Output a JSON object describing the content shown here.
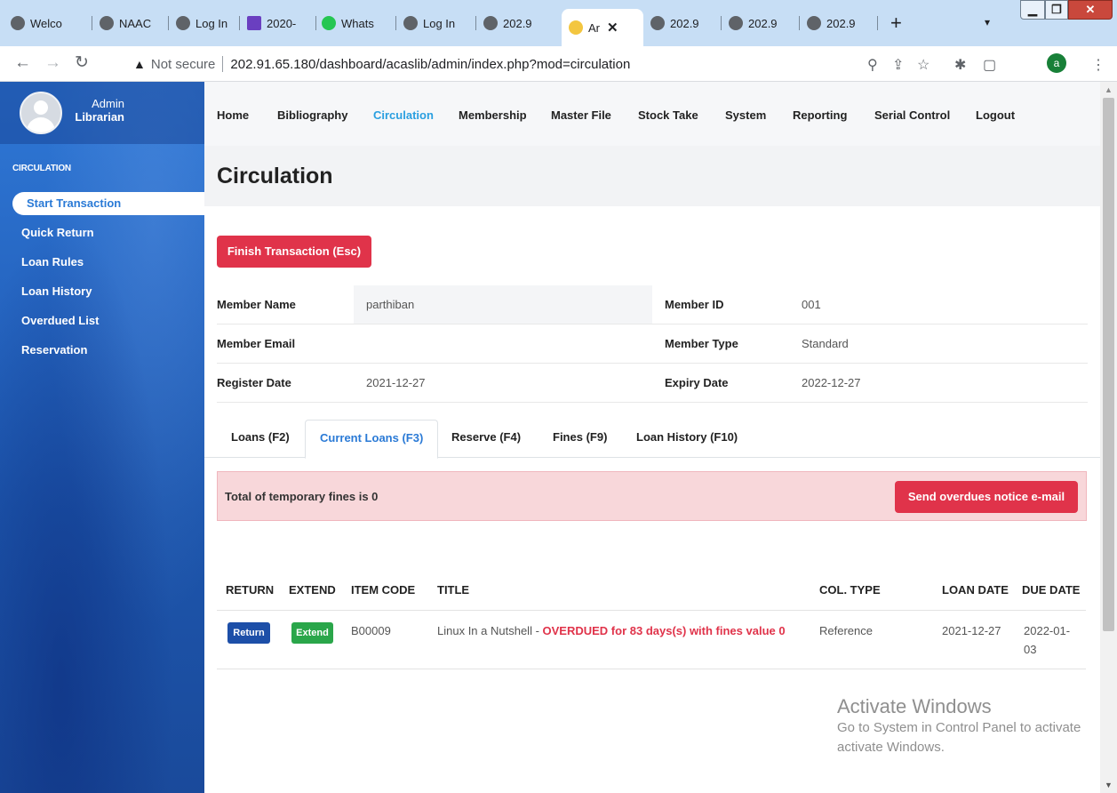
{
  "browser": {
    "tabs": [
      {
        "title": "Welco",
        "icon": "globe-icon"
      },
      {
        "title": "NAAC",
        "icon": "globe-icon"
      },
      {
        "title": "Log In",
        "icon": "globe-icon"
      },
      {
        "title": "2020-",
        "icon": "forms-icon"
      },
      {
        "title": "Whats",
        "icon": "whatsapp-icon"
      },
      {
        "title": "Log In",
        "icon": "globe-icon"
      },
      {
        "title": "202.9",
        "icon": "globe-icon"
      },
      {
        "title": "Ar",
        "icon": "smile-icon",
        "active": true
      },
      {
        "title": "202.9",
        "icon": "globe-icon"
      },
      {
        "title": "202.9",
        "icon": "globe-icon"
      },
      {
        "title": "202.9",
        "icon": "globe-icon"
      }
    ],
    "security_label": "Not secure",
    "url": "202.91.65.180/dashboard/acaslib/admin/index.php?mod=circulation",
    "profile_initial": "a"
  },
  "sidebar": {
    "user_role": "Admin",
    "user_title": "Librarian",
    "section": "CIRCULATION",
    "items": [
      {
        "label": "Start Transaction",
        "active": true
      },
      {
        "label": "Quick Return"
      },
      {
        "label": "Loan Rules"
      },
      {
        "label": "Loan History"
      },
      {
        "label": "Overdued List"
      },
      {
        "label": "Reservation"
      }
    ]
  },
  "topnav": {
    "items": [
      "Home",
      "Bibliography",
      "Circulation",
      "Membership",
      "Master File",
      "Stock Take",
      "System",
      "Reporting",
      "Serial Control",
      "Logout"
    ],
    "current": "Circulation"
  },
  "page": {
    "title": "Circulation",
    "finish_button": "Finish Transaction (Esc)"
  },
  "member": {
    "name_label": "Member Name",
    "name": "parthiban",
    "id_label": "Member ID",
    "id": "001",
    "email_label": "Member Email",
    "email": "",
    "type_label": "Member Type",
    "type": "Standard",
    "register_label": "Register Date",
    "register": "2021-12-27",
    "expiry_label": "Expiry Date",
    "expiry": "2022-12-27"
  },
  "tabs": [
    {
      "label": "Loans (F2)"
    },
    {
      "label": "Current Loans (F3)",
      "active": true
    },
    {
      "label": "Reserve (F4)"
    },
    {
      "label": "Fines (F9)"
    },
    {
      "label": "Loan History (F10)"
    }
  ],
  "alert": {
    "text": "Total of temporary fines is 0",
    "button": "Send overdues notice e-mail"
  },
  "loans": {
    "headers": [
      "RETURN",
      "EXTEND",
      "ITEM CODE",
      "TITLE",
      "COL. TYPE",
      "LOAN DATE",
      "DUE DATE"
    ],
    "rows": [
      {
        "return_label": "Return",
        "extend_label": "Extend",
        "item_code": "B00009",
        "title": "Linux In a Nutshell - ",
        "overdue_note": "OVERDUED for 83 days(s) with fines value 0",
        "col_type": "Reference",
        "loan_date": "2021-12-27",
        "due_date_1": "2022-01-",
        "due_date_2": "03"
      }
    ]
  },
  "watermark": {
    "line1": "Activate Windows",
    "line2": "Go to System in Control Panel to activate",
    "line3": "activate Windows."
  },
  "colors": {
    "accent": "#2a9fe0",
    "danger": "#e0334a",
    "return": "#1d4fa8",
    "extend": "#2aa64a",
    "sidebar": "#2666c2"
  }
}
